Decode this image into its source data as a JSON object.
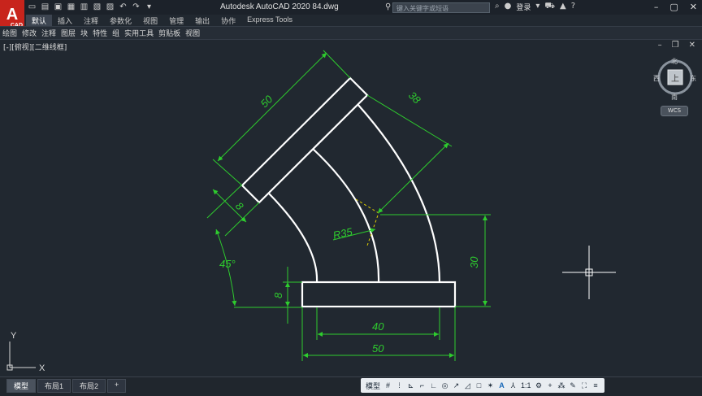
{
  "app": {
    "logo_letter": "A",
    "logo_sub": "CAD",
    "title": "Autodesk AutoCAD 2020    84.dwg",
    "search_placeholder": "键入关键字或短语",
    "login_label": "登录"
  },
  "ribbon_tabs": [
    "默认",
    "插入",
    "注释",
    "参数化",
    "视图",
    "管理",
    "输出",
    "协作",
    "Express Tools"
  ],
  "menu_items": [
    "绘图",
    "修改",
    "注释",
    "图层",
    "块",
    "特性",
    "组",
    "实用工具",
    "剪贴板",
    "视图"
  ],
  "viewport": {
    "label": "[-][俯视][二维线框]"
  },
  "viewcube": {
    "north": "北",
    "south": "南",
    "east": "东",
    "west": "西",
    "face": "上",
    "wcs": "WCS"
  },
  "ucs": {
    "x": "X",
    "y": "Y"
  },
  "dimensions": {
    "d50_top": "50",
    "d38": "38",
    "d8_left": "8",
    "r35": "R35",
    "angle": "45°",
    "d8_base": "8",
    "d30": "30",
    "d40": "40",
    "d50_bottom": "50"
  },
  "layout_tabs": [
    "模型",
    "布局1",
    "布局2",
    "+"
  ],
  "status": {
    "model": "模型",
    "scale": "1:1"
  },
  "colors": {
    "background": "#212830",
    "geometry": "#ffffff",
    "dimension": "#2ecc2e",
    "centerline": "#e0d000"
  }
}
